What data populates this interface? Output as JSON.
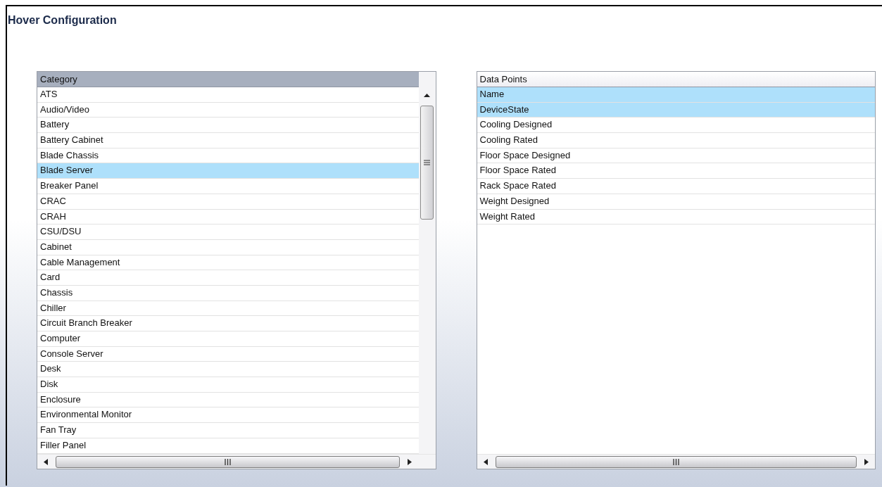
{
  "window": {
    "title": "Hover Configuration"
  },
  "lists": [
    {
      "header": {
        "label": "Category",
        "highlighted": true
      },
      "vertical_scrollbar": true,
      "rows": [
        {
          "label": "ATS",
          "selected": false
        },
        {
          "label": "Audio/Video",
          "selected": false
        },
        {
          "label": "Battery",
          "selected": false
        },
        {
          "label": "Battery Cabinet",
          "selected": false
        },
        {
          "label": "Blade Chassis",
          "selected": false
        },
        {
          "label": "Blade Server",
          "selected": true
        },
        {
          "label": "Breaker Panel",
          "selected": false
        },
        {
          "label": "CRAC",
          "selected": false
        },
        {
          "label": "CRAH",
          "selected": false
        },
        {
          "label": "CSU/DSU",
          "selected": false
        },
        {
          "label": "Cabinet",
          "selected": false
        },
        {
          "label": "Cable Management",
          "selected": false
        },
        {
          "label": "Card",
          "selected": false
        },
        {
          "label": "Chassis",
          "selected": false
        },
        {
          "label": "Chiller",
          "selected": false
        },
        {
          "label": "Circuit Branch Breaker",
          "selected": false
        },
        {
          "label": "Computer",
          "selected": false
        },
        {
          "label": "Console Server",
          "selected": false
        },
        {
          "label": "Desk",
          "selected": false
        },
        {
          "label": "Disk",
          "selected": false
        },
        {
          "label": "Enclosure",
          "selected": false
        },
        {
          "label": "Environmental Monitor",
          "selected": false
        },
        {
          "label": "Fan Tray",
          "selected": false
        },
        {
          "label": "Filler Panel",
          "selected": false
        }
      ]
    },
    {
      "header": {
        "label": "Data Points",
        "highlighted": false
      },
      "vertical_scrollbar": false,
      "rows": [
        {
          "label": "Name",
          "selected": true
        },
        {
          "label": "DeviceState",
          "selected": true
        },
        {
          "label": "Cooling Designed",
          "selected": false
        },
        {
          "label": "Cooling Rated",
          "selected": false
        },
        {
          "label": "Floor Space Designed",
          "selected": false
        },
        {
          "label": "Floor Space Rated",
          "selected": false
        },
        {
          "label": "Rack Space Rated",
          "selected": false
        },
        {
          "label": "Weight Designed",
          "selected": false
        },
        {
          "label": "Weight Rated",
          "selected": false
        }
      ]
    }
  ]
}
